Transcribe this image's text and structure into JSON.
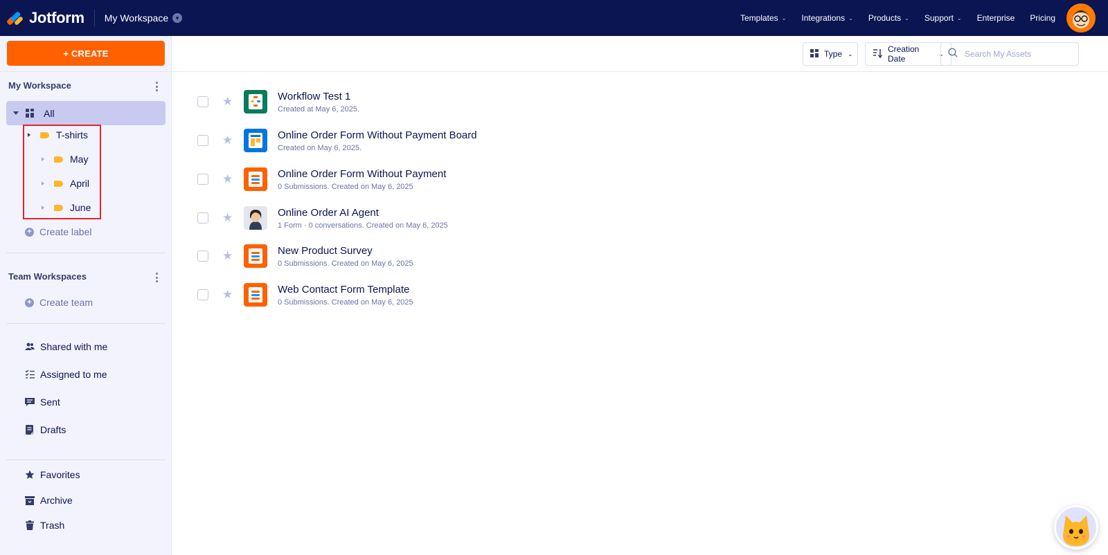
{
  "brand": {
    "name": "Jotform"
  },
  "header": {
    "workspace_switcher": "My Workspace",
    "nav": [
      {
        "label": "Templates",
        "has_menu": true
      },
      {
        "label": "Integrations",
        "has_menu": true
      },
      {
        "label": "Products",
        "has_menu": true
      },
      {
        "label": "Support",
        "has_menu": true
      },
      {
        "label": "Enterprise",
        "has_menu": false
      },
      {
        "label": "Pricing",
        "has_menu": false
      }
    ]
  },
  "sidebar": {
    "create_label": "+ CREATE",
    "my_workspace_title": "My Workspace",
    "all_label": "All",
    "labels": [
      {
        "name": "T-shirts",
        "level": 0
      },
      {
        "name": "May",
        "level": 1
      },
      {
        "name": "April",
        "level": 1
      },
      {
        "name": "June",
        "level": 1
      }
    ],
    "create_label_text": "Create label",
    "team_title": "Team Workspaces",
    "create_team_text": "Create team",
    "nav": [
      {
        "label": "Shared with me",
        "icon": "users-icon"
      },
      {
        "label": "Assigned to me",
        "icon": "checklist-icon"
      },
      {
        "label": "Sent",
        "icon": "chat-icon"
      },
      {
        "label": "Drafts",
        "icon": "draft-icon"
      }
    ],
    "nav2": [
      {
        "label": "Favorites",
        "icon": "star-icon"
      },
      {
        "label": "Archive",
        "icon": "archive-icon"
      },
      {
        "label": "Trash",
        "icon": "trash-icon"
      }
    ]
  },
  "toolbar": {
    "type_label": "Type",
    "sort_label": "Creation Date",
    "search_placeholder": "Search My Assets"
  },
  "assets": [
    {
      "title": "Workflow Test 1",
      "subtitle": "Created at May 6, 2025.",
      "icon": "workflow-icon",
      "color": "#0b7a5e"
    },
    {
      "title": "Online Order Form Without Payment Board",
      "subtitle": "Created on May 6, 2025.",
      "icon": "board-icon",
      "color": "#0075e3"
    },
    {
      "title": "Online Order Form Without Payment",
      "subtitle": "0 Submissions. Created on May 6, 2025",
      "icon": "form-icon",
      "color": "#ff6100"
    },
    {
      "title": "Online Order AI Agent",
      "subtitle": "1 Form · 0 conversations. Created on May 6, 2025",
      "icon": "agent-avatar-icon",
      "color": "#e7eaf5"
    },
    {
      "title": "New Product Survey",
      "subtitle": "0 Submissions. Created on May 6, 2025",
      "icon": "form-icon",
      "color": "#ff6100"
    },
    {
      "title": "Web Contact Form Template",
      "subtitle": "0 Submissions. Created on May 6, 2025",
      "icon": "form-icon",
      "color": "#ff6100"
    }
  ],
  "colors": {
    "header_bg": "#0a1551",
    "create_orange": "#ff6100",
    "highlight_red": "#e8232b",
    "tag_yellow": "#ffb629"
  }
}
